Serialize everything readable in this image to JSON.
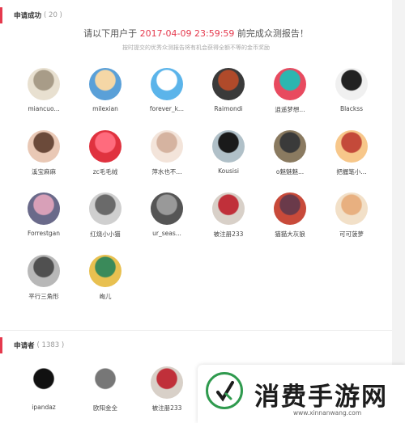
{
  "success_section": {
    "title": "申请成功",
    "count": "( 20 )"
  },
  "notice": {
    "prefix": "请以下用户于",
    "datetime": "2017-04-09 23:59:59",
    "suffix": "前完成众测报告！",
    "sub": "按时提交的优秀众测报告将有机会获得全额不等的金币奖励"
  },
  "success_users": [
    {
      "name": "miancuo...",
      "colors": [
        "#e8e0d0",
        "#a89c88"
      ]
    },
    {
      "name": "milexian",
      "colors": [
        "#5aa0d8",
        "#f5d7a6"
      ]
    },
    {
      "name": "forever_k...",
      "colors": [
        "#5bb4ea",
        "#ffffff"
      ]
    },
    {
      "name": "Raimondi",
      "colors": [
        "#3a3a3a",
        "#b04a2a"
      ]
    },
    {
      "name": "逍遥梦想...",
      "colors": [
        "#e84a5f",
        "#2bb6b0"
      ]
    },
    {
      "name": "Blackss",
      "colors": [
        "#f0f0f0",
        "#222222"
      ]
    },
    {
      "name": "溪宝麻麻",
      "colors": [
        "#e9c8b5",
        "#6b4a3a"
      ]
    },
    {
      "name": "zc毛毛绒",
      "colors": [
        "#e0323f",
        "#ff6b7d"
      ]
    },
    {
      "name": "萍水也不...",
      "colors": [
        "#f3e4da",
        "#d5b3a0"
      ]
    },
    {
      "name": "Kousisi",
      "colors": [
        "#b0c0c8",
        "#1a1a1a"
      ]
    },
    {
      "name": "o魅魅魅...",
      "colors": [
        "#8a7a60",
        "#3a3a3a"
      ]
    },
    {
      "name": "把握笔小...",
      "colors": [
        "#f7c78a",
        "#c44a3a"
      ]
    },
    {
      "name": "Forrestgan",
      "colors": [
        "#6a6a8a",
        "#d8a0b8"
      ]
    },
    {
      "name": "红烧小小猫",
      "colors": [
        "#cfcfcf",
        "#6a6a6a"
      ]
    },
    {
      "name": "ur_seas...",
      "colors": [
        "#555555",
        "#999999"
      ]
    },
    {
      "name": "被注册233",
      "colors": [
        "#d8d0c8",
        "#c0303a"
      ]
    },
    {
      "name": "猫猫大灰狼",
      "colors": [
        "#c84a3a",
        "#6a3a4a"
      ]
    },
    {
      "name": "可可菠萝",
      "colors": [
        "#f2e0c8",
        "#e8b080"
      ]
    },
    {
      "name": "平行三角形",
      "colors": [
        "#b8b8b8",
        "#505050"
      ]
    },
    {
      "name": "峋儿",
      "colors": [
        "#e8c050",
        "#3a8a5a"
      ]
    }
  ],
  "applicants_section": {
    "title": "申请者",
    "count": "( 1383 )"
  },
  "applicant_users": [
    {
      "name": "ipandaz",
      "colors": [
        "#ffffff",
        "#111111"
      ]
    },
    {
      "name": "欧阳金全",
      "colors": [
        "#ffffff",
        "#777777"
      ]
    },
    {
      "name": "被注册233",
      "colors": [
        "#d8d0c8",
        "#c0303a"
      ]
    },
    {
      "name": "",
      "colors": [
        "#e0323f",
        "#e0323f"
      ]
    },
    {
      "name": "",
      "colors": [
        "#e8e8e8",
        "#cfcfcf"
      ]
    },
    {
      "name": "",
      "colors": [
        "#5bb4ea",
        "#5bb4ea"
      ]
    }
  ],
  "watermark": {
    "title": "消费手游网",
    "url": "www.xinnanwang.com"
  }
}
